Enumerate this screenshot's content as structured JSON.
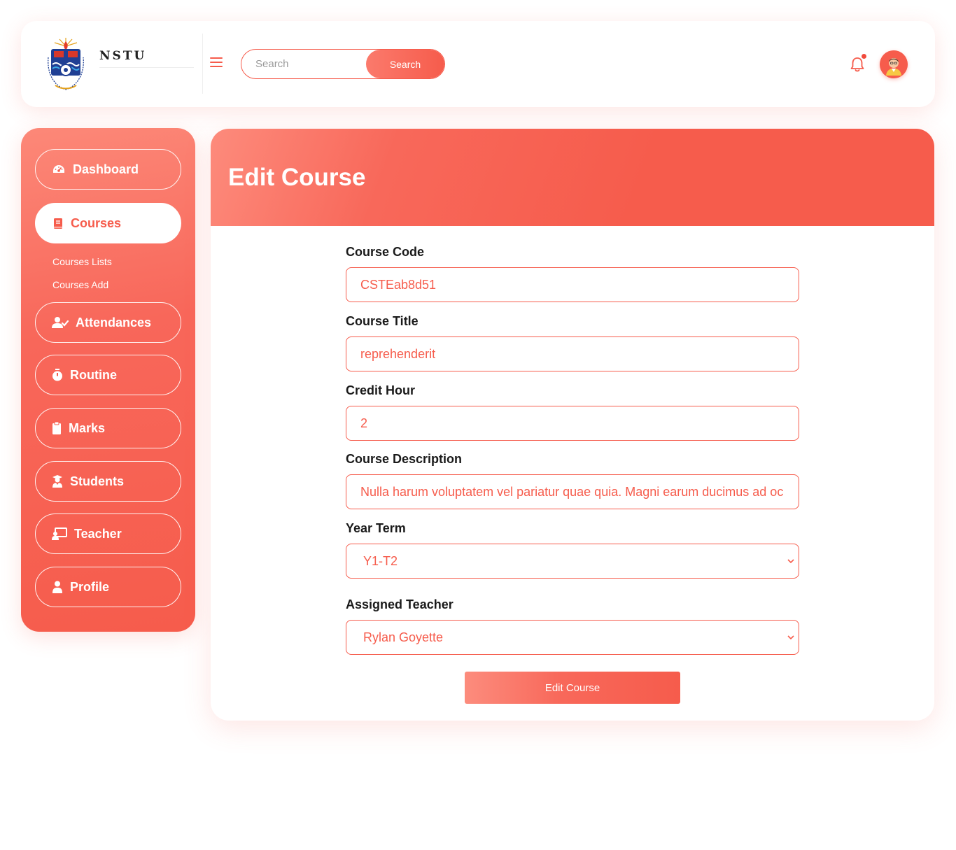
{
  "brand": {
    "name": "NSTU"
  },
  "search": {
    "placeholder": "Search",
    "button_label": "Search"
  },
  "colors": {
    "accent": "#f65c4c",
    "accent_light": "#fc8878"
  },
  "sidebar": {
    "items": [
      {
        "label": "Dashboard",
        "icon": "dashboard-icon"
      },
      {
        "label": "Courses",
        "icon": "book-icon",
        "active": true,
        "subitems": [
          {
            "label": "Courses Lists"
          },
          {
            "label": "Courses Add"
          }
        ]
      },
      {
        "label": "Attendances",
        "icon": "user-check-icon"
      },
      {
        "label": "Routine",
        "icon": "stopwatch-icon"
      },
      {
        "label": "Marks",
        "icon": "clipboard-icon"
      },
      {
        "label": "Students",
        "icon": "graduate-icon"
      },
      {
        "label": "Teacher",
        "icon": "teacher-board-icon"
      },
      {
        "label": "Profile",
        "icon": "user-icon"
      }
    ]
  },
  "page": {
    "title": "Edit Course",
    "fields": {
      "course_code": {
        "label": "Course Code",
        "value": "CSTEab8d51"
      },
      "course_title": {
        "label": "Course Title",
        "value": "reprehenderit"
      },
      "credit_hour": {
        "label": "Credit Hour",
        "value": "2"
      },
      "course_description": {
        "label": "Course Description",
        "value": "Nulla harum voluptatem vel pariatur quae quia. Magni earum ducimus ad oc"
      },
      "year_term": {
        "label": "Year Term",
        "value": "Y1-T2"
      },
      "assigned_teacher": {
        "label": "Assigned Teacher",
        "value": "Rylan Goyette"
      }
    },
    "submit_label": "Edit Course"
  }
}
